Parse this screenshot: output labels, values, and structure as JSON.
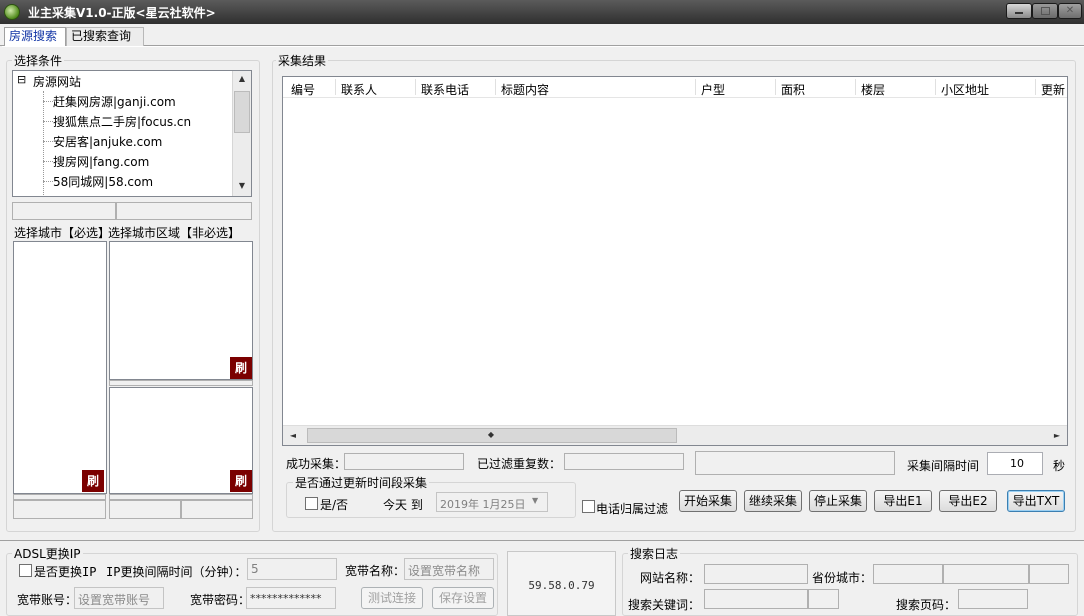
{
  "window": {
    "title": "业主采集V1.0-正版<星云社软件>"
  },
  "tabs": [
    {
      "label": "房源搜索"
    },
    {
      "label": "已搜索查询"
    }
  ],
  "conditions": {
    "group_title": "选择条件",
    "tree_root": "房源网站",
    "tree_toggle": "⊟",
    "tree_items": [
      "赶集网房源|ganji.com",
      "搜狐焦点二手房|focus.cn",
      "安居客|anjuke.com",
      "搜房网|fang.com",
      "58同城网|58.com"
    ],
    "city_label": "选择城市【必选】",
    "district_label": "选择城市区域【非必选】",
    "refresh_label": "刷"
  },
  "results": {
    "group_title": "采集结果",
    "columns": [
      "编号",
      "联系人",
      "联系电话",
      "标题内容",
      "户型",
      "面积",
      "楼层",
      "小区地址",
      "更新"
    ],
    "success_label": "成功采集：",
    "filtered_label": "已过滤重复数：",
    "interval_label": "采集间隔时间",
    "interval_value": "10",
    "interval_unit": "秒",
    "time_group_title": "是否通过更新时间段采集",
    "yes_no_label": "是/否",
    "today_to_label": "今天 到",
    "date_value": "2019年 1月25日",
    "phone_filter_label": "电话归属过滤",
    "buttons": {
      "start": "开始采集",
      "continue": "继续采集",
      "stop": "停止采集",
      "export_e1": "导出E1",
      "export_e2": "导出E2",
      "export_txt": "导出TXT"
    }
  },
  "adsl": {
    "group_title": "ADSL更换IP",
    "change_ip_label": "是否更换IP",
    "interval_label": "IP更换间隔时间（分钟）：",
    "interval_value": "5",
    "broadband_name_label": "宽带名称：",
    "broadband_name_placeholder": "设置宽带名称",
    "account_label": "宽带账号：",
    "account_placeholder": "设置宽带账号",
    "password_label": "宽带密码：",
    "password_value": "*************",
    "test_button": "测试连接",
    "save_button": "保存设置",
    "ip_address": "59.58.0.79"
  },
  "search_log": {
    "group_title": "搜索日志",
    "site_label": "网站名称：",
    "province_label": "省份城市：",
    "keyword_label": "搜索关键词：",
    "page_label": "搜索页码："
  }
}
